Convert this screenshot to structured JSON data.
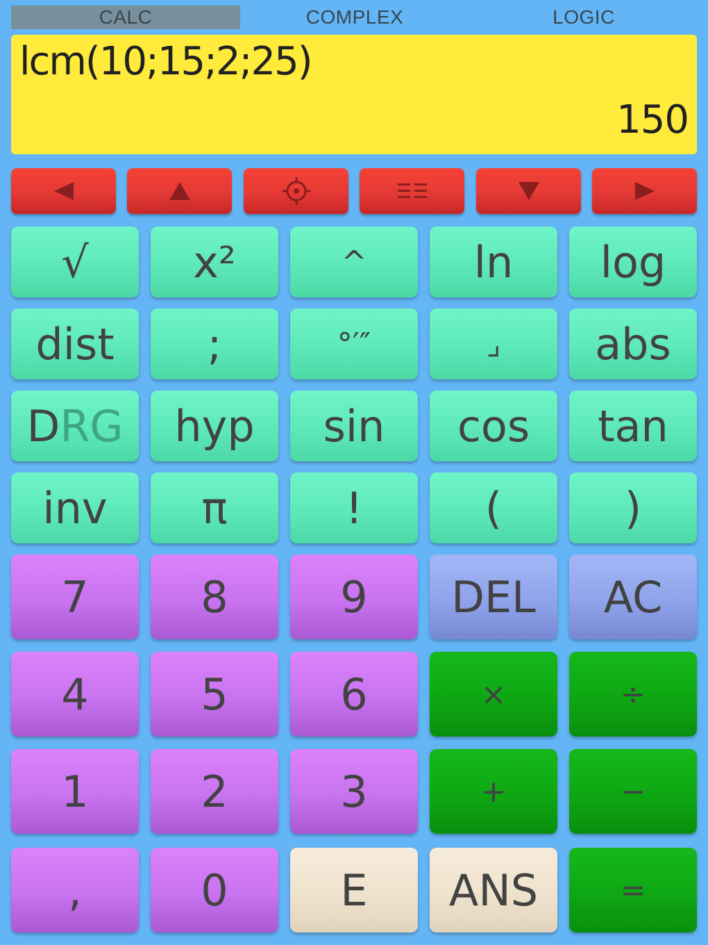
{
  "tabs": [
    {
      "label": "CALC",
      "active": true
    },
    {
      "label": "COMPLEX",
      "active": false
    },
    {
      "label": "LOGIC",
      "active": false
    }
  ],
  "display": {
    "expression": "lcm(10;15;2;25)",
    "result": "150"
  },
  "nav_buttons": [
    "left-arrow-icon",
    "up-arrow-icon",
    "settings-icon",
    "menu-icon",
    "down-arrow-icon",
    "right-arrow-icon"
  ],
  "keys": {
    "row1": [
      "√",
      "x²",
      "^",
      "ln",
      "log"
    ],
    "row2": [
      "dist",
      ";",
      "°′″",
      "⌟",
      "abs"
    ],
    "row3": {
      "drg_d": "D",
      "drg_rg": "RG",
      "hyp": "hyp",
      "sin": "sin",
      "cos": "cos",
      "tan": "tan"
    },
    "row4": [
      "inv",
      "π",
      "!",
      "(",
      ")"
    ],
    "row5": [
      "7",
      "8",
      "9",
      "DEL",
      "AC"
    ],
    "row6": [
      "4",
      "5",
      "6",
      "×",
      "÷"
    ],
    "row7": [
      "1",
      "2",
      "3",
      "+",
      "−"
    ],
    "row8": [
      ",",
      "0",
      "E",
      "ANS",
      "="
    ]
  },
  "colors": {
    "background": "#64b5f6",
    "display": "#ffeb3b",
    "nav": "#e53935",
    "function_keys": "#5ee8b8",
    "number_keys": "#c873ef",
    "edit_keys": "#8fa3ea",
    "operator_keys": "#0ea713",
    "special_keys": "#efe2cd"
  }
}
